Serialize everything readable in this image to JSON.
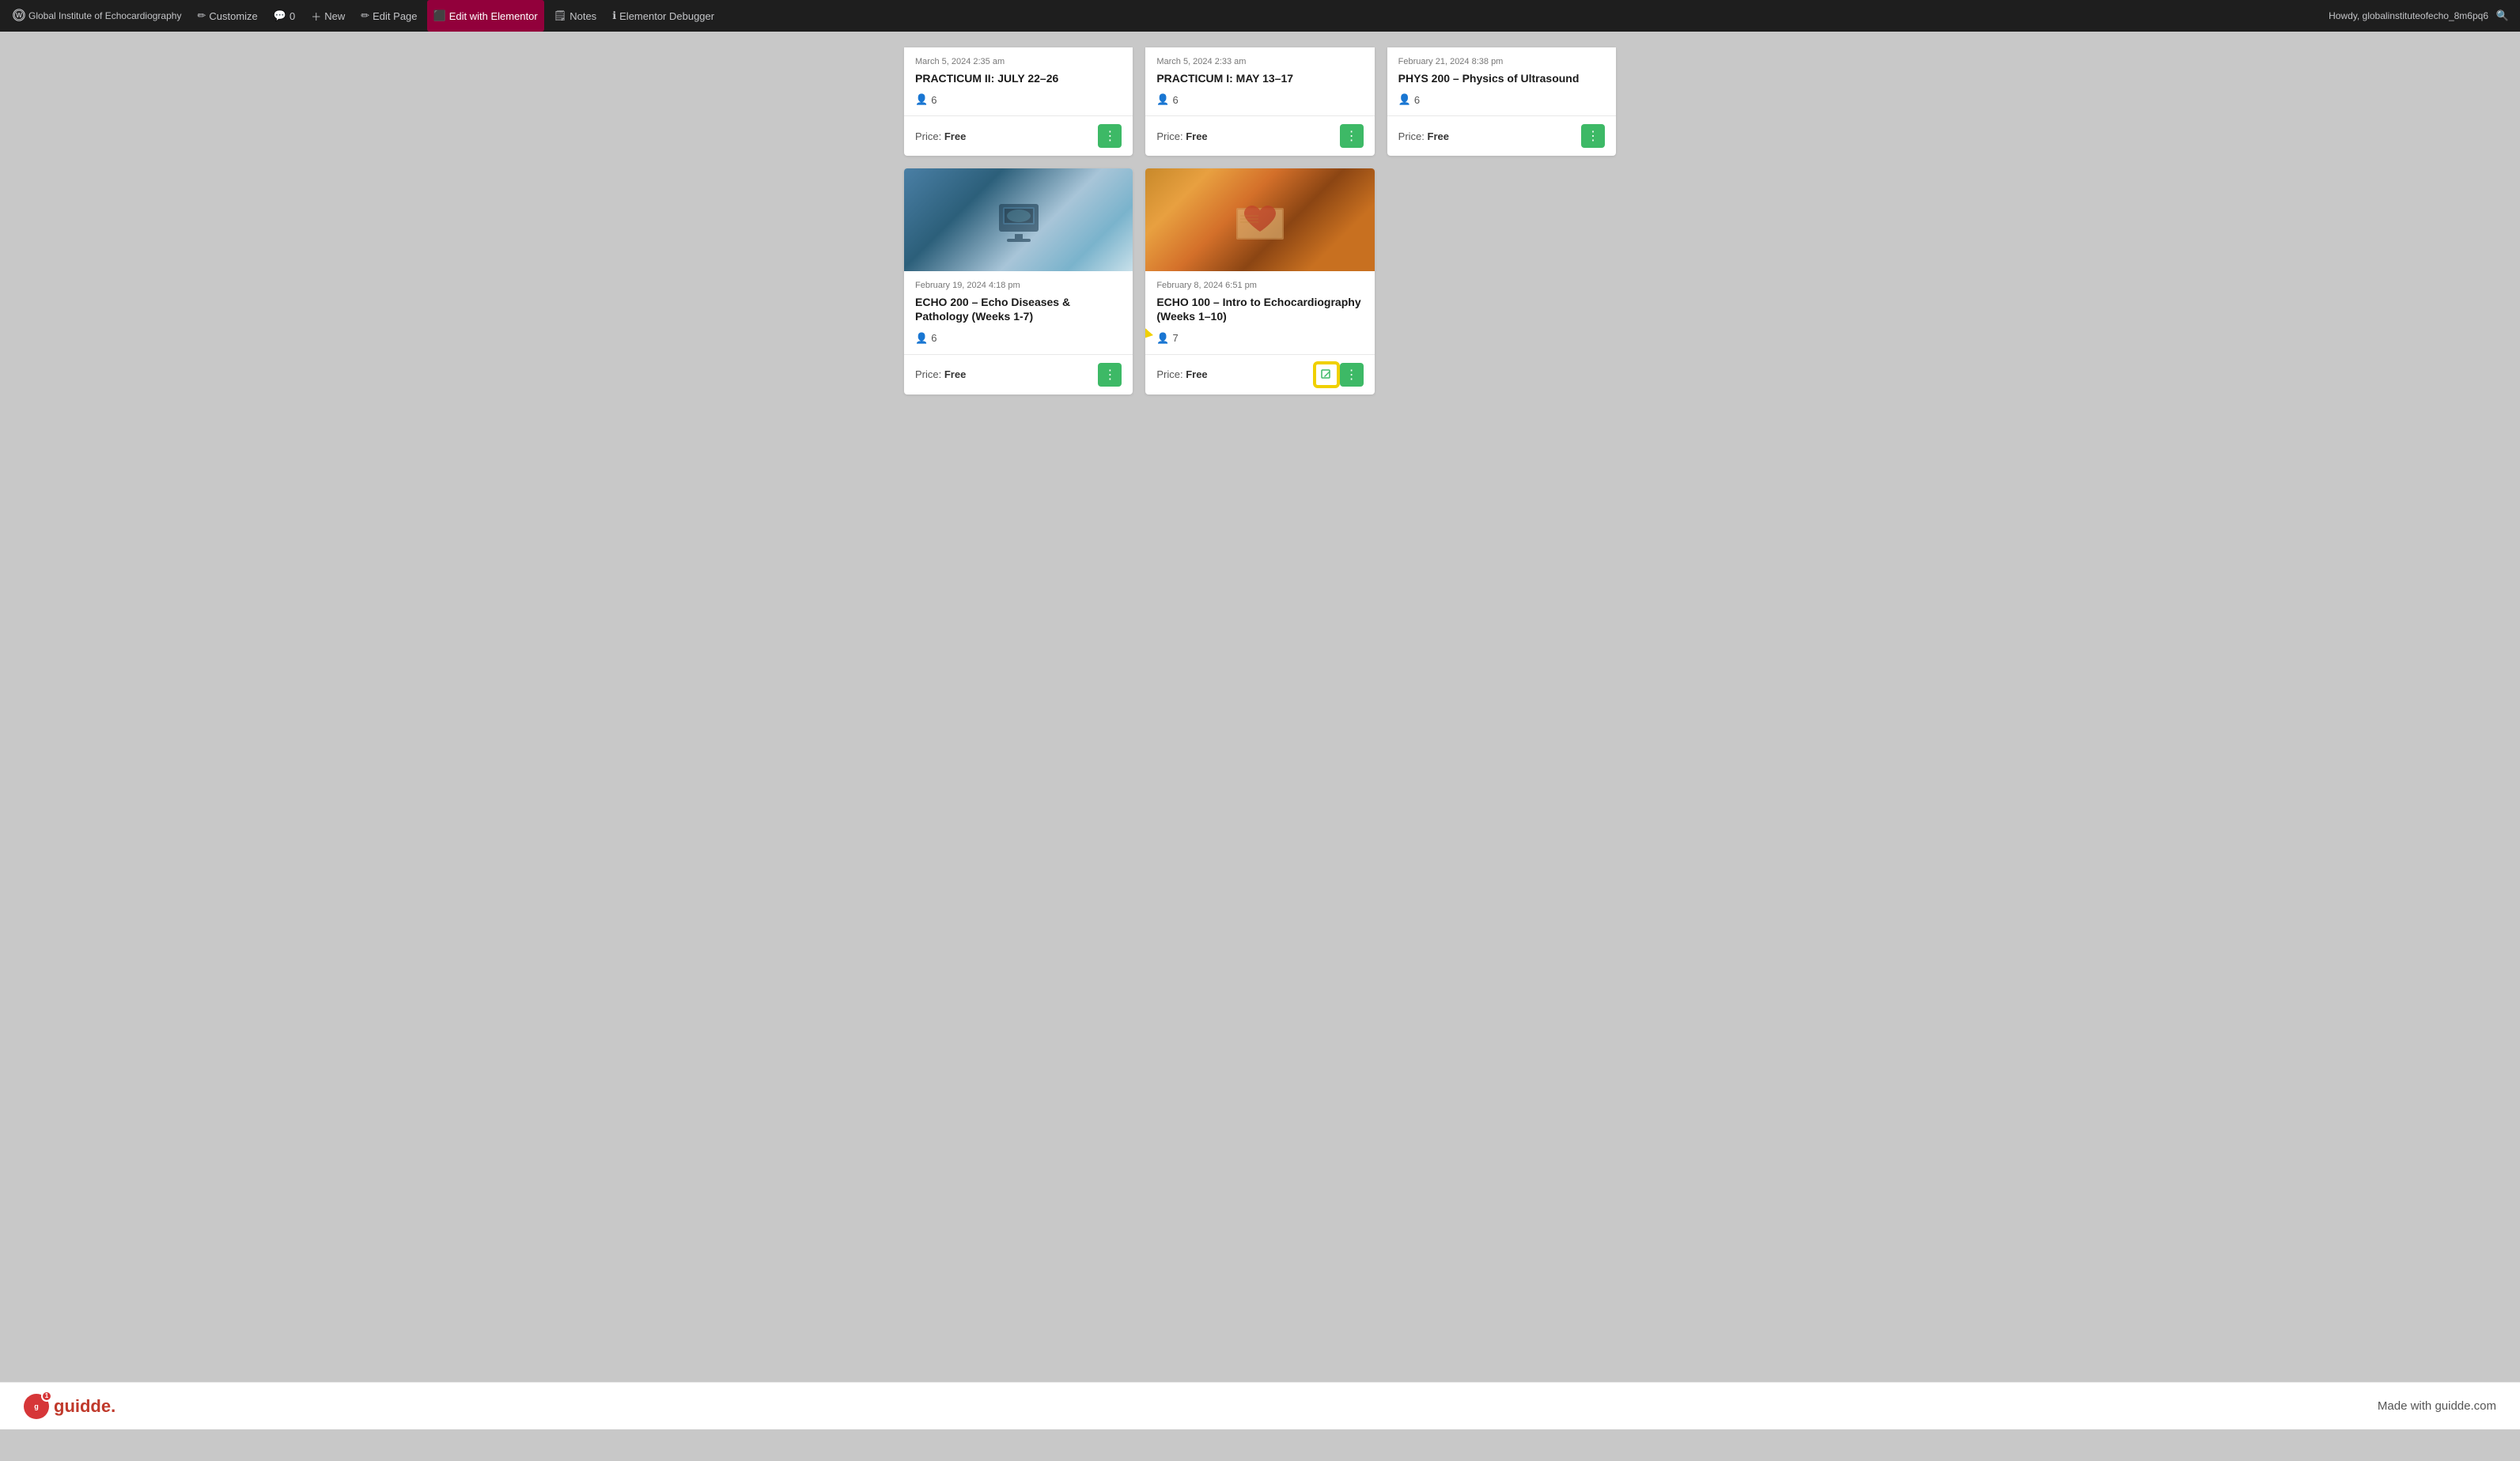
{
  "adminBar": {
    "siteName": "Global Institute of Echocardiography",
    "items": [
      {
        "id": "site-name",
        "label": "Global Institute of Echocardiography",
        "icon": "wp"
      },
      {
        "id": "customize",
        "label": "Customize",
        "icon": "pencil"
      },
      {
        "id": "comments",
        "label": "0",
        "icon": "bubble"
      },
      {
        "id": "new",
        "label": "New",
        "icon": "plus"
      },
      {
        "id": "edit-page",
        "label": "Edit Page",
        "icon": "pencil"
      },
      {
        "id": "edit-elementor",
        "label": "Edit with Elementor",
        "icon": "elementor"
      },
      {
        "id": "notes",
        "label": "Notes",
        "icon": "note"
      },
      {
        "id": "elementor-debug",
        "label": "Elementor Debugger",
        "icon": "info"
      }
    ],
    "userLabel": "Howdy, globalinstituteofecho_8m6pq6"
  },
  "topCards": [
    {
      "date": "March 5, 2024 2:35 am",
      "title": "PRACTICUM II: JULY 22–26",
      "students": "6",
      "priceLabel": "Price:",
      "price": "Free"
    },
    {
      "date": "March 5, 2024 2:33 am",
      "title": "PRACTICUM I: MAY 13–17",
      "students": "6",
      "priceLabel": "Price:",
      "price": "Free"
    },
    {
      "date": "February 21, 2024 8:38 pm",
      "title": "PHYS 200 – Physics of Ultrasound",
      "students": "6",
      "priceLabel": "Price:",
      "price": "Free"
    }
  ],
  "bottomCards": [
    {
      "date": "February 19, 2024 4:18 pm",
      "title": "ECHO 200 – Echo Diseases & Pathology (Weeks 1-7)",
      "students": "6",
      "priceLabel": "Price:",
      "price": "Free",
      "hasImage": true,
      "imageType": "ultrasound"
    },
    {
      "date": "February 8, 2024 6:51 pm",
      "title": "ECHO 100 – Intro to Echocardiography (Weeks 1–10)",
      "students": "7",
      "priceLabel": "Price:",
      "price": "Free",
      "hasImage": true,
      "imageType": "heart",
      "highlighted": true
    }
  ],
  "footer": {
    "logoText": "guidde.",
    "badgeNumber": "1",
    "rightText": "Made with guidde.com"
  },
  "buttons": {
    "menuLabel": "⋮",
    "editLabel": "✎"
  }
}
